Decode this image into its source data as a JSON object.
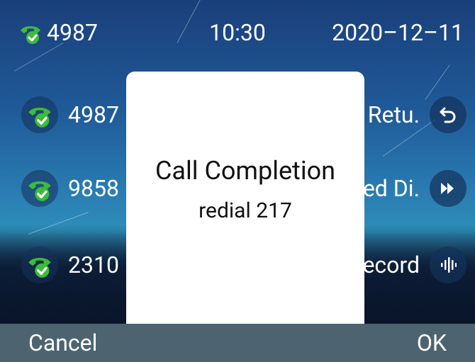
{
  "status_bar": {
    "line_id": "4987",
    "time": "10:30",
    "date": "2020–12–11"
  },
  "call_list": [
    {
      "number": "4987",
      "icon": "phone-check-icon"
    },
    {
      "number": "9858",
      "icon": "phone-check-icon"
    },
    {
      "number": "2310",
      "icon": "phone-check-icon"
    }
  ],
  "actions": [
    {
      "label": "Retu.",
      "icon": "return-arrow-icon"
    },
    {
      "label": "ed Di.",
      "icon": "fast-forward-icon"
    },
    {
      "label": "ecord",
      "icon": "voice-waveform-icon"
    }
  ],
  "dialog": {
    "title": "Call Completion",
    "message": "redial 217"
  },
  "softkeys": {
    "left": "Cancel",
    "right": "OK"
  },
  "colors": {
    "phone_green": "#3dbb3b",
    "softkey_bar": "#4d6470"
  }
}
